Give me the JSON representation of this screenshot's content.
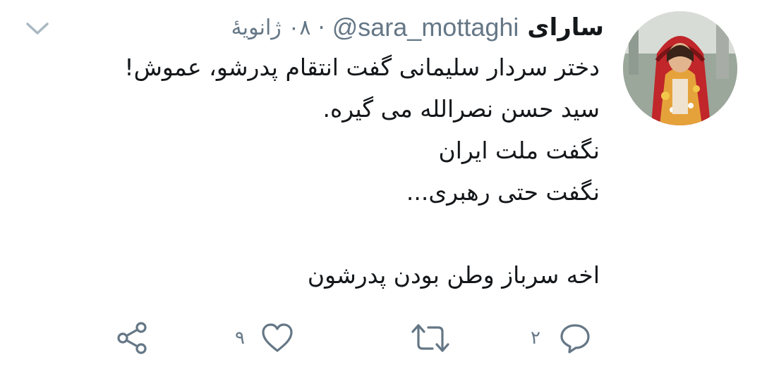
{
  "tweet": {
    "author": {
      "display_name": "سارای",
      "handle": "@sara_mottaghi"
    },
    "separator": "·",
    "timestamp": "۰۸ ژانویهٔ",
    "text_lines": [
      "دختر سردار سلیمانی گفت انتقام پدرشو، عموش!",
      "سید حسن نصرالله می گیره.",
      "نگفت ملت ایران",
      "نگفت حتی رهبری...",
      "",
      "اخه سرباز وطن بودن پدرشون"
    ],
    "actions": {
      "reply_count": "۲",
      "retweet_count": "",
      "like_count": "۹"
    },
    "icons": {
      "caret": "chevron-down-icon",
      "reply": "reply-icon",
      "retweet": "retweet-icon",
      "like": "heart-icon",
      "share": "share-icon"
    },
    "colors": {
      "text": "#14171a",
      "secondary": "#657786",
      "icon": "#657786",
      "background": "#ffffff"
    }
  }
}
